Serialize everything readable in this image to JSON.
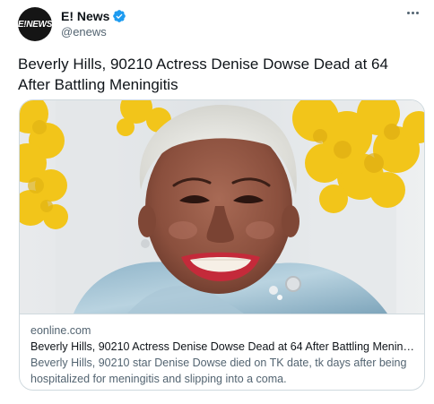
{
  "account": {
    "display_name": "E! News",
    "handle": "@enews",
    "avatar_text": "E!NEWS",
    "verified": true,
    "avatar_icon": "e-news-logo-icon"
  },
  "tweet": {
    "text": "Beverly Hills, 90210 Actress Denise Dowse Dead at 64 After Battling Meningitis"
  },
  "card": {
    "domain": "eonline.com",
    "title": "Beverly Hills, 90210 Actress Denise Dowse Dead at 64 After Battling Meningiti...",
    "description": "Beverly Hills, 90210 star Denise Dowse died on TK date, tk days after being hospitalized for meningitis and slipping into a coma."
  },
  "icons": {
    "verified": "verified-badge-icon",
    "more": "more-options-icon"
  },
  "colors": {
    "verified_blue": "#1d9bf0",
    "secondary_text": "#536471",
    "border": "#cfd9de"
  }
}
